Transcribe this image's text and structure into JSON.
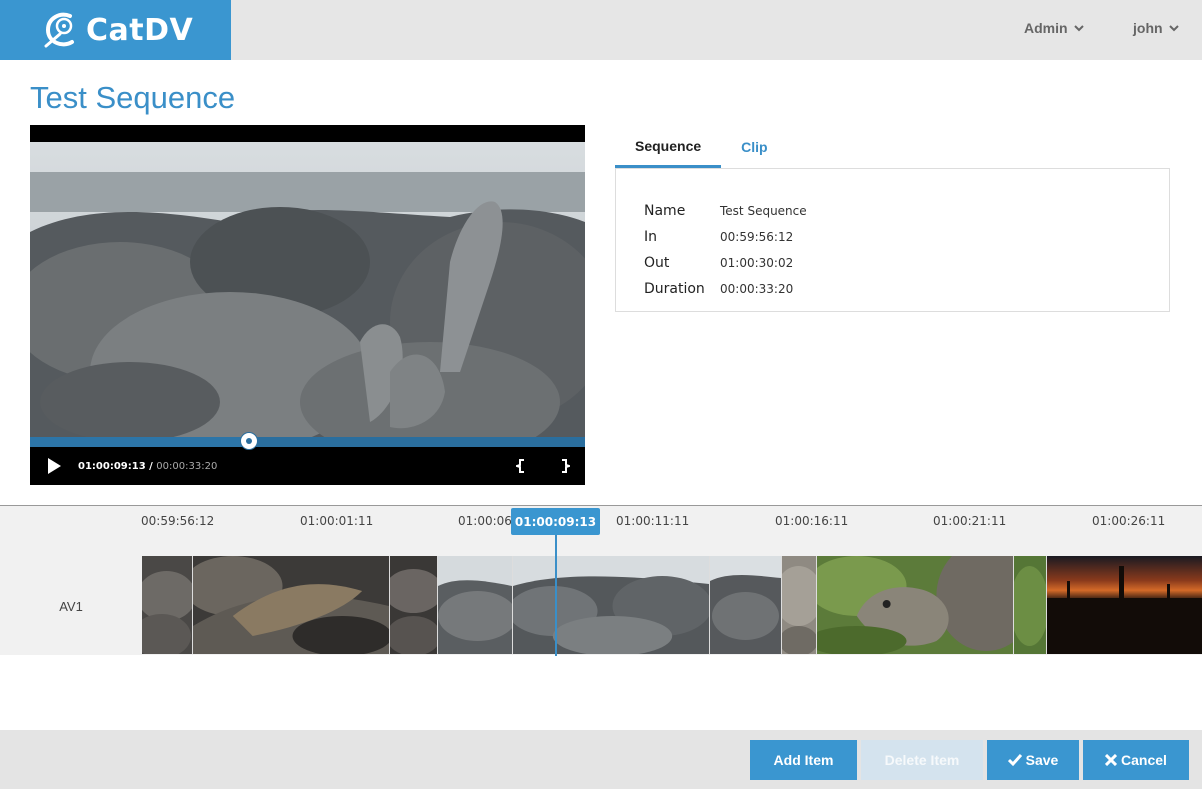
{
  "header": {
    "logo_text": "CatDV",
    "admin_label": "Admin",
    "user_label": "john"
  },
  "page": {
    "title": "Test Sequence"
  },
  "player": {
    "current_time": "01:00:09:13",
    "separator": " / ",
    "total_time": "00:00:33:20",
    "progress_fraction": 0.395
  },
  "tabs": [
    {
      "label": "Sequence",
      "active": true
    },
    {
      "label": "Clip",
      "active": false
    }
  ],
  "details": [
    {
      "label": "Name",
      "value": "Test Sequence"
    },
    {
      "label": "In",
      "value": "00:59:56:12"
    },
    {
      "label": "Out",
      "value": "01:00:30:02"
    },
    {
      "label": "Duration",
      "value": "00:00:33:20"
    }
  ],
  "timeline": {
    "ticks": [
      "00:59:56:12",
      "01:00:01:11",
      "01:00:06:",
      "01:00:11:11",
      "01:00:16:11",
      "01:00:21:11",
      "01:00:26:11"
    ],
    "playhead_time": "01:00:09:13",
    "track_label": "AV1"
  },
  "footer": {
    "add_label": "Add Item",
    "delete_label": "Delete Item",
    "save_label": "Save",
    "cancel_label": "Cancel"
  },
  "colors": {
    "accent": "#3a96d0",
    "title": "#3a8fc8",
    "disabled": "#d4e3ee"
  }
}
